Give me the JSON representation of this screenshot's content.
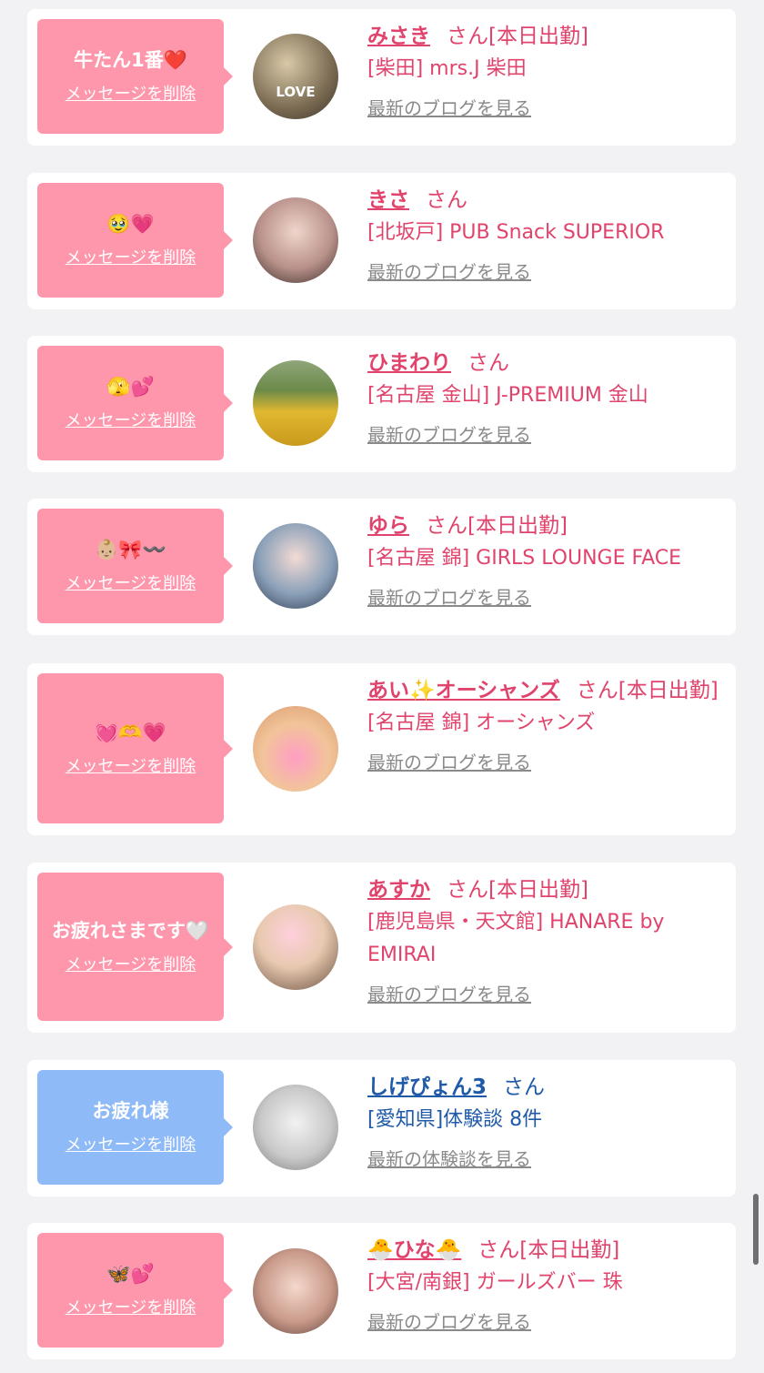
{
  "cards": [
    {
      "message": "牛たん1番❤️",
      "delete": "メッセージを削除",
      "name": "みさき",
      "san": "さん",
      "status": "[本日出勤]",
      "shop": "[柴田] mrs.J 柴田",
      "blog": "最新のブログを見る",
      "avatar_text": "LOVE"
    },
    {
      "message": "🥹💗",
      "delete": "メッセージを削除",
      "name": "きさ",
      "san": "さん",
      "status": "",
      "shop": "[北坂戸] PUB Snack SUPERIOR",
      "blog": "最新のブログを見る"
    },
    {
      "message": "🫣💕",
      "delete": "メッセージを削除",
      "name": "ひまわり",
      "san": "さん",
      "status": "",
      "shop": "[名古屋 金山] J-PREMIUM 金山",
      "blog": "最新のブログを見る"
    },
    {
      "message": "👶🏼🎀〰️",
      "delete": "メッセージを削除",
      "name": "ゆら",
      "san": "さん",
      "status": "[本日出勤]",
      "shop": "[名古屋 錦] GIRLS LOUNGE FACE",
      "blog": "最新のブログを見る"
    },
    {
      "message": "💓🫶💗",
      "delete": "メッセージを削除",
      "name": "あい✨オーシャンズ",
      "san": "さん",
      "status": "[本日出勤]",
      "shop": "[名古屋 錦] オーシャンズ",
      "blog": "最新のブログを見る"
    },
    {
      "message": "お疲れさまです🤍",
      "delete": "メッセージを削除",
      "name": "あすか",
      "san": "さん",
      "status": "[本日出勤]",
      "shop": "[鹿児島県・天文館] HANARE by EMIRAI",
      "blog": "最新のブログを見る"
    },
    {
      "message": "お疲れ様",
      "delete": "メッセージを削除",
      "name": "しげぴょん3",
      "san": "さん",
      "status": "",
      "shop": "[愛知県]体験談 8件",
      "blog": "最新の体験談を見る"
    },
    {
      "message": "🦋💕",
      "delete": "メッセージを削除",
      "name": "🐣ひな🐣",
      "san": "さん",
      "status": "[本日出勤]",
      "shop": "[大宮/南銀] ガールズバー 珠",
      "blog": "最新のブログを見る"
    }
  ],
  "colors": {
    "pink": "#ff97ac",
    "blue": "#8fbaf8",
    "name_pink": "#e0436b",
    "name_blue": "#1f5aa8"
  }
}
